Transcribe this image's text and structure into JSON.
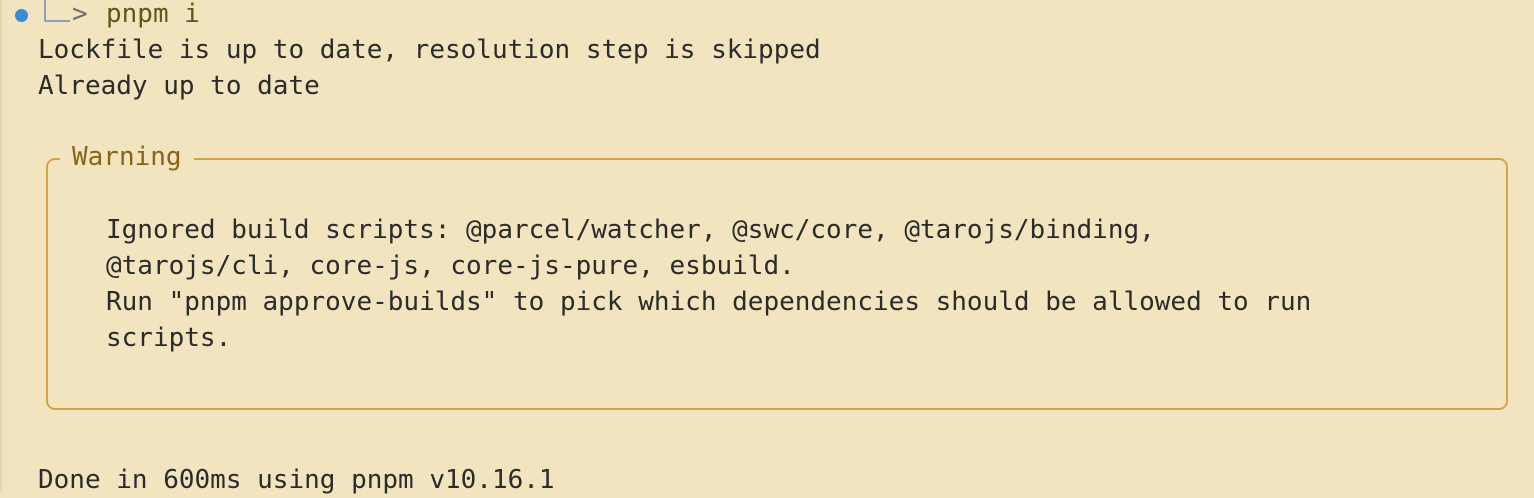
{
  "prompt": {
    "arrow": ">",
    "command": "pnpm i"
  },
  "output": {
    "line1": "Lockfile is up to date, resolution step is skipped",
    "line2": "Already up to date"
  },
  "warning": {
    "title": "Warning",
    "lines": [
      "Ignored build scripts: @parcel/watcher, @swc/core, @tarojs/binding,",
      "@tarojs/cli, core-js, core-js-pure, esbuild.",
      "Run \"pnpm approve-builds\" to pick which dependencies should be allowed to run",
      "scripts."
    ]
  },
  "footer": {
    "done": "Done in 600ms using pnpm v10.16.1"
  },
  "colors": {
    "background": "#f1e4be",
    "warning_border": "#d4a448",
    "warning_title": "#8a6417",
    "status_dot": "#3b8ad9"
  }
}
